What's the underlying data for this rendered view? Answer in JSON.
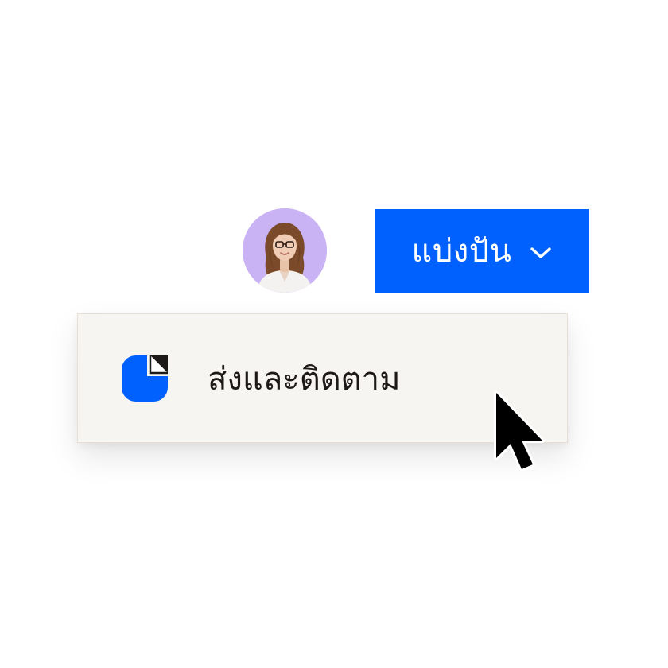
{
  "share_button": {
    "label": "แบ่งปัน",
    "chevron_icon": "chevron-down-icon",
    "color": "#0061fe"
  },
  "avatar": {
    "icon": "user-avatar",
    "background": "#c9b3f5"
  },
  "dropdown": {
    "items": [
      {
        "label": "ส่งและติดตาม",
        "icon": "send-and-track-icon",
        "icon_color": "#0061fe"
      }
    ],
    "background": "#f7f5f2"
  },
  "cursor": {
    "icon": "mouse-pointer-icon"
  }
}
